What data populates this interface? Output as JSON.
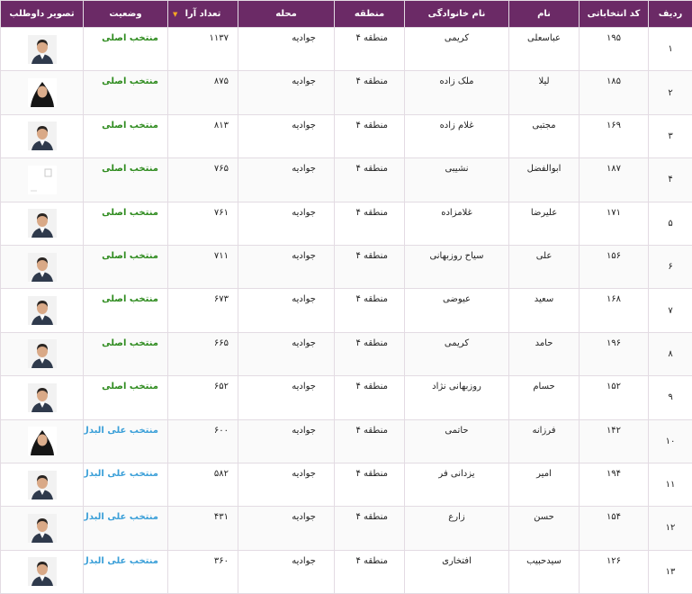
{
  "headers": {
    "row": "ردیف",
    "code": "کد انتخاباتی",
    "first_name": "نام",
    "last_name": "نام خانوادگی",
    "region": "منطقه",
    "area": "محله",
    "votes": "تعداد آرا",
    "status": "وضعیت",
    "photo": "تصویر داوطلب"
  },
  "colors": {
    "header_bg": "#6b2a66",
    "status_main": "#2e8b1e",
    "status_reserve": "#3a9fd8",
    "sort_arrow": "#f5a623"
  },
  "rows": [
    {
      "row": "۱",
      "code": "۱۹۵",
      "first_name": "عباسعلی",
      "last_name": "کریمی",
      "region": "منطقه ۴",
      "area": "جوادیه",
      "votes": "۱۱۳۷",
      "status": "منتخب اصلی",
      "status_type": "main",
      "photo": "male-photo-icon"
    },
    {
      "row": "۲",
      "code": "۱۸۵",
      "first_name": "لیلا",
      "last_name": "ملک زاده",
      "region": "منطقه ۴",
      "area": "جوادیه",
      "votes": "۸۷۵",
      "status": "منتخب اصلی",
      "status_type": "main",
      "photo": "female-photo-icon"
    },
    {
      "row": "۳",
      "code": "۱۶۹",
      "first_name": "مجتبی",
      "last_name": "غلام زاده",
      "region": "منطقه ۴",
      "area": "جوادیه",
      "votes": "۸۱۳",
      "status": "منتخب اصلی",
      "status_type": "main",
      "photo": "male-photo-icon"
    },
    {
      "row": "۴",
      "code": "۱۸۷",
      "first_name": "ابوالفضل",
      "last_name": "نشیبی",
      "region": "منطقه ۴",
      "area": "جوادیه",
      "votes": "۷۶۵",
      "status": "منتخب اصلی",
      "status_type": "main",
      "photo": "placeholder-photo-icon"
    },
    {
      "row": "۵",
      "code": "۱۷۱",
      "first_name": "علیرضا",
      "last_name": "غلامزاده",
      "region": "منطقه ۴",
      "area": "جوادیه",
      "votes": "۷۶۱",
      "status": "منتخب اصلی",
      "status_type": "main",
      "photo": "male-photo-icon"
    },
    {
      "row": "۶",
      "code": "۱۵۶",
      "first_name": "علی",
      "last_name": "سیاح روزبهانی",
      "region": "منطقه ۴",
      "area": "جوادیه",
      "votes": "۷۱۱",
      "status": "منتخب اصلی",
      "status_type": "main",
      "photo": "male-photo-icon"
    },
    {
      "row": "۷",
      "code": "۱۶۸",
      "first_name": "سعید",
      "last_name": "عیوضی",
      "region": "منطقه ۴",
      "area": "جوادیه",
      "votes": "۶۷۳",
      "status": "منتخب اصلی",
      "status_type": "main",
      "photo": "male-photo-icon"
    },
    {
      "row": "۸",
      "code": "۱۹۶",
      "first_name": "حامد",
      "last_name": "کریمی",
      "region": "منطقه ۴",
      "area": "جوادیه",
      "votes": "۶۶۵",
      "status": "منتخب اصلی",
      "status_type": "main",
      "photo": "male-photo-icon"
    },
    {
      "row": "۹",
      "code": "۱۵۲",
      "first_name": "حسام",
      "last_name": "روزبهانی نژاد",
      "region": "منطقه ۴",
      "area": "جوادیه",
      "votes": "۶۵۲",
      "status": "منتخب اصلی",
      "status_type": "main",
      "photo": "male-photo-icon"
    },
    {
      "row": "۱۰",
      "code": "۱۴۲",
      "first_name": "فرزانه",
      "last_name": "حاتمی",
      "region": "منطقه ۴",
      "area": "جوادیه",
      "votes": "۶۰۰",
      "status": "منتخب علی البدل",
      "status_type": "reserve",
      "photo": "female-photo-icon"
    },
    {
      "row": "۱۱",
      "code": "۱۹۴",
      "first_name": "امیر",
      "last_name": "یزدانی فر",
      "region": "منطقه ۴",
      "area": "جوادیه",
      "votes": "۵۸۲",
      "status": "منتخب علی البدل",
      "status_type": "reserve",
      "photo": "male-photo-icon"
    },
    {
      "row": "۱۲",
      "code": "۱۵۴",
      "first_name": "حسن",
      "last_name": "زارع",
      "region": "منطقه ۴",
      "area": "جوادیه",
      "votes": "۴۳۱",
      "status": "منتخب علی البدل",
      "status_type": "reserve",
      "photo": "male-photo-icon"
    },
    {
      "row": "۱۳",
      "code": "۱۲۶",
      "first_name": "سیدحبیب",
      "last_name": "افتخاری",
      "region": "منطقه ۴",
      "area": "جوادیه",
      "votes": "۳۶۰",
      "status": "منتخب علی البدل",
      "status_type": "reserve",
      "photo": "male-photo-icon"
    }
  ]
}
